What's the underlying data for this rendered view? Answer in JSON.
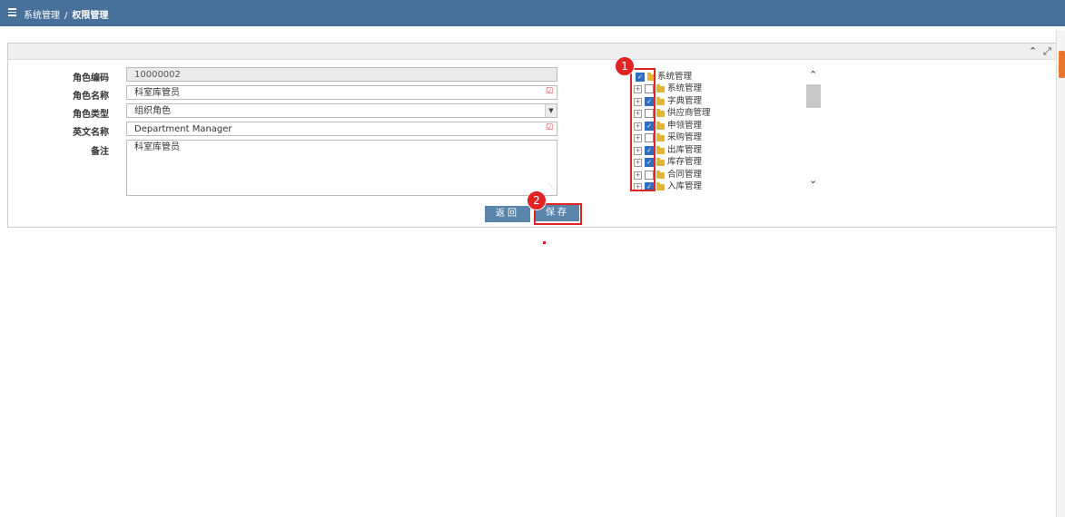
{
  "header": {
    "breadcrumb_parent": "系统管理",
    "breadcrumb_separator": "/",
    "breadcrumb_current": "权限管理"
  },
  "form": {
    "role_code_label": "角色编码",
    "role_code_value": "10000002",
    "role_name_label": "角色名称",
    "role_name_value": "科室库管员",
    "role_type_label": "角色类型",
    "role_type_value": "组织角色",
    "english_name_label": "英文名称",
    "english_name_value": "Department Manager",
    "remark_label": "备注",
    "remark_value": "科室库管员"
  },
  "buttons": {
    "back_label": "返回",
    "save_label": "保存"
  },
  "tree": {
    "root": {
      "label": "系统管理",
      "checked": true
    },
    "children": [
      {
        "label": "系统管理",
        "checked": false
      },
      {
        "label": "字典管理",
        "checked": true
      },
      {
        "label": "供应商管理",
        "checked": false
      },
      {
        "label": "申领管理",
        "checked": true
      },
      {
        "label": "采购管理",
        "checked": false
      },
      {
        "label": "出库管理",
        "checked": true
      },
      {
        "label": "库存管理",
        "checked": true
      },
      {
        "label": "合同管理",
        "checked": false
      },
      {
        "label": "入库管理",
        "checked": true
      }
    ]
  },
  "annotations": {
    "badge_1": "1",
    "badge_2": "2"
  },
  "colors": {
    "header_bg": "#47709a",
    "button_bg": "#5b86ab",
    "highlight": "#e02424",
    "checkbox_checked": "#2e6fbf",
    "folder": "#e1b532"
  }
}
